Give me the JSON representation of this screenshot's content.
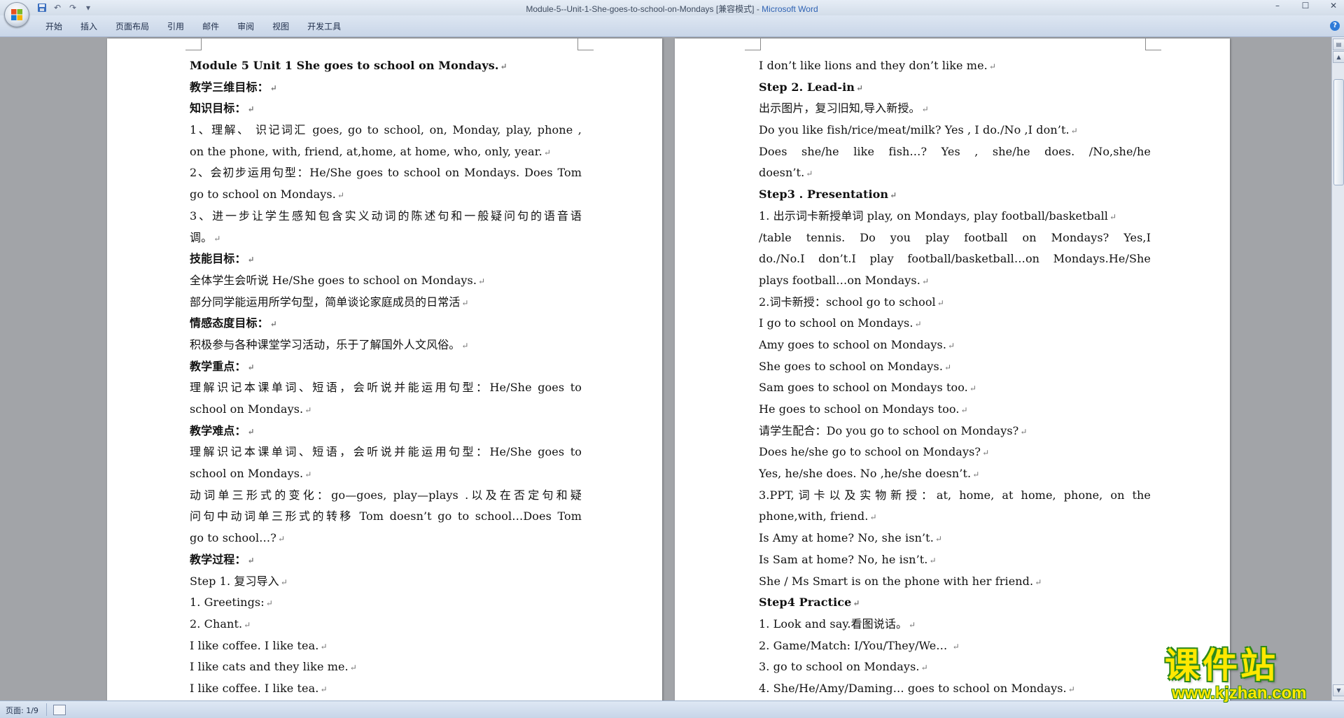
{
  "window": {
    "title_document": "Module-5--Unit-1-She-goes-to-school-on-Mondays [兼容模式] - ",
    "title_app": "Microsoft Word",
    "controls": [
      "–",
      "☐",
      "✕"
    ]
  },
  "quick_access": [
    "save-icon",
    "undo-icon",
    "redo-icon",
    "customize-icon"
  ],
  "ribbon": {
    "tabs": [
      "开始",
      "插入",
      "页面布局",
      "引用",
      "邮件",
      "审阅",
      "视图",
      "开发工具"
    ],
    "help": "?"
  },
  "document": {
    "paragraph_mark": "↵",
    "left_page": [
      {
        "text": "Module 5   Unit 1 She goes to school on Mondays.",
        "bold": true
      },
      {
        "text": "教学三维目标：",
        "bold": true
      },
      {
        "text": "知识目标：",
        "bold": true
      },
      {
        "text": "1、理解、 识记词汇 goes, go to school, on, Monday, play, phone ,",
        "just": true,
        "nomark": true
      },
      {
        "text": "on the phone, with, friend, at,home, at home, who, only, year."
      },
      {
        "text": "2、会初步运用句型：He/She goes to school on Mondays. Does Tom",
        "just": true,
        "nomark": true
      },
      {
        "text": "go to school on Mondays."
      },
      {
        "text": "3、进一步让学生感知包含实义动词的陈述句和一般疑问句的语音语",
        "just": true,
        "nomark": true
      },
      {
        "text": "调。"
      },
      {
        "text": "技能目标：",
        "bold": true
      },
      {
        "text": "全体学生会听说 He/She goes to school on Mondays."
      },
      {
        "text": "部分同学能运用所学句型，简单谈论家庭成员的日常活"
      },
      {
        "text": "情感态度目标：",
        "bold": true
      },
      {
        "text": "积极参与各种课堂学习活动，乐于了解国外人文风俗。"
      },
      {
        "text": "教学重点：",
        "bold": true
      },
      {
        "text": "理解识记本课单词、短语，会听说并能运用句型：He/She goes to",
        "just": true,
        "nomark": true
      },
      {
        "text": "school on Mondays."
      },
      {
        "text": "教学难点：",
        "bold": true
      },
      {
        "text": "理解识记本课单词、短语，会听说并能运用句型：He/She goes to",
        "just": true,
        "nomark": true
      },
      {
        "text": "school on Mondays."
      },
      {
        "text": "动词单三形式的变化：go—goes, play—plays .以及在否定句和疑",
        "just": true,
        "nomark": true
      },
      {
        "text": "问句中动词单三形式的转移 Tom doesn’t go to school…Does Tom",
        "just": true,
        "nomark": true
      },
      {
        "text": "go to school…?"
      },
      {
        "text": "教学过程：",
        "bold": true
      },
      {
        "text": "Step 1. 复习导入"
      },
      {
        "text": "1. Greetings:"
      },
      {
        "text": "2. Chant."
      },
      {
        "text": "I like coffee.  I like tea."
      },
      {
        "text": "I like cats and they like me."
      },
      {
        "text": "I like coffee.  I like tea."
      }
    ],
    "right_page": [
      {
        "text": "I don’t like lions and they don’t like me."
      },
      {
        "text": "Step 2. Lead-in",
        "bold": true
      },
      {
        "text": "出示图片，复习旧知,导入新授。"
      },
      {
        "text": "Do you like fish/rice/meat/milk?  Yes , I do./No ,I don’t."
      },
      {
        "text": "Does she/he like fish…?          Yes , she/he does. /No,she/he",
        "just": true,
        "nomark": true
      },
      {
        "text": "doesn’t."
      },
      {
        "text": "Step3 . Presentation",
        "bold": true
      },
      {
        "text": "1. 出示词卡新授单词 play, on Mondays, play football/basketball"
      },
      {
        "text": "/table tennis. Do you play football on Mondays?      Yes,I",
        "just": true,
        "nomark": true
      },
      {
        "text": "do./No.I don’t.I play football/basketball…on Mondays.He/She",
        "just": true,
        "nomark": true
      },
      {
        "text": "plays football…on Mondays."
      },
      {
        "text": "2.词卡新授：school   go to school"
      },
      {
        "text": "I go to school on Mondays."
      },
      {
        "text": "Amy goes to school on Mondays."
      },
      {
        "text": "She goes to school on Mondays."
      },
      {
        "text": "Sam goes to school on Mondays too."
      },
      {
        "text": "He goes to school on Mondays too."
      },
      {
        "text": "请学生配合：Do you go to school on Mondays?"
      },
      {
        "text": "Does he/she go to school on Mondays?"
      },
      {
        "text": "Yes, he/she does.      No ,he/she doesn’t."
      },
      {
        "text": "3.PPT,词卡以及实物新授：at, home, at home, phone, on the",
        "just": true,
        "nomark": true
      },
      {
        "text": "phone,with, friend."
      },
      {
        "text": "Is Amy at home? No, she isn’t."
      },
      {
        "text": "Is Sam at home? No, he isn’t."
      },
      {
        "text": "She / Ms Smart is on the phone with her friend."
      },
      {
        "text": "Step4 Practice",
        "bold": true
      },
      {
        "text": "1. Look and say.看图说话。"
      },
      {
        "text": "2. Game/Match: I/You/They/We…       "
      },
      {
        "text": "3. go to school on Mondays."
      },
      {
        "text": "4. She/He/Amy/Daming…  goes to school on Mondays."
      }
    ]
  },
  "status": {
    "page_info": "页面: 1/9"
  },
  "watermark": {
    "title": "课件站",
    "url": "www.kjzhan.com"
  },
  "colors": {
    "workspace_bg": "#a2a4a8",
    "title_app": "#2f63b4",
    "watermark_fill": "#ffe800",
    "watermark_stroke": "#2f8a1c"
  }
}
